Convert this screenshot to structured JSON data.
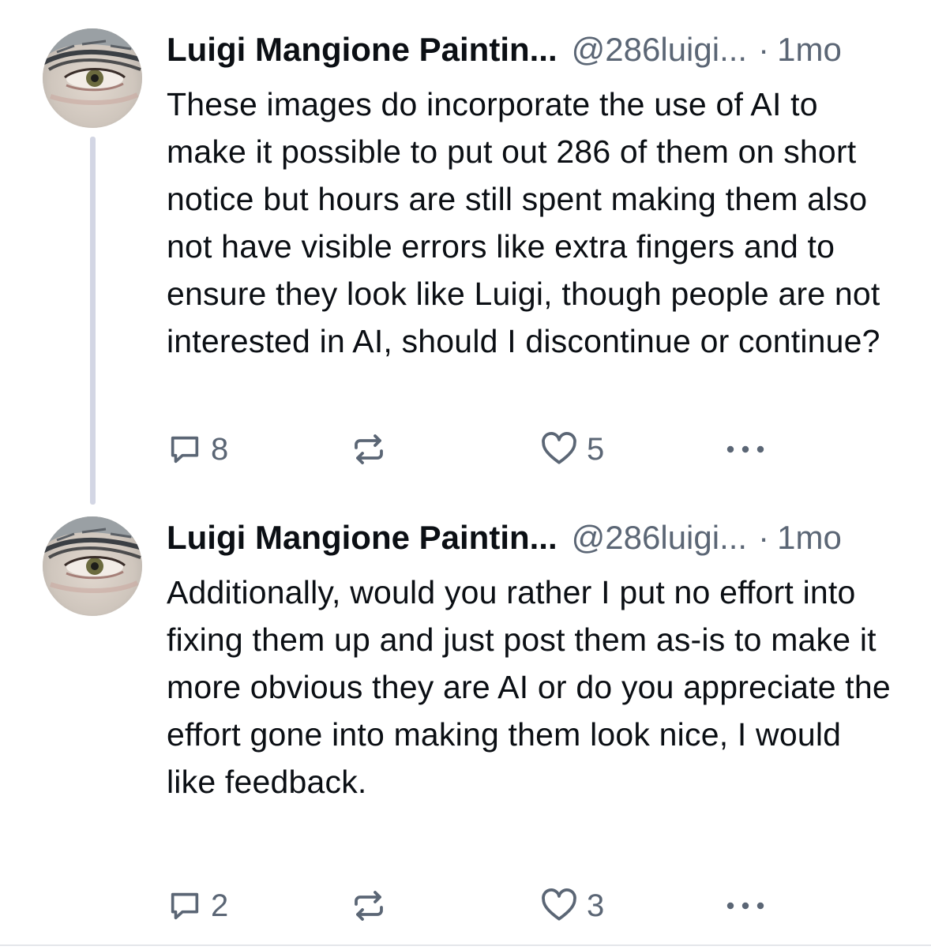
{
  "posts": [
    {
      "author_name": "Luigi Mangione Paintin...",
      "handle": "@286luigi...",
      "separator": "·",
      "time": "1mo",
      "text": "These images do incorporate the use of AI to make it possible to put out 286 of them on short notice but hours are still spent making them also not have visible errors like extra fingers and to ensure they look like Luigi, though people are not interested in AI, should I discontinue or continue?",
      "reply_count": "8",
      "repost_count": "",
      "like_count": "5"
    },
    {
      "author_name": "Luigi Mangione Paintin...",
      "handle": "@286luigi...",
      "separator": "·",
      "time": "1mo",
      "text": "Additionally, would you rather I put no effort into fixing them up and just post them as-is to make it more obvious they are AI or do you appreciate the effort gone into making them look nice, I would like feedback.",
      "reply_count": "2",
      "repost_count": "",
      "like_count": "3"
    }
  ],
  "icons": {
    "reply": "speech-bubble-icon",
    "repost": "repost-arrows-icon",
    "like": "heart-icon",
    "more": "ellipsis-icon"
  },
  "colors": {
    "text_primary": "#0b0f14",
    "text_secondary": "#5b6675",
    "thread_line": "#d3d6e4",
    "background": "#ffffff"
  }
}
